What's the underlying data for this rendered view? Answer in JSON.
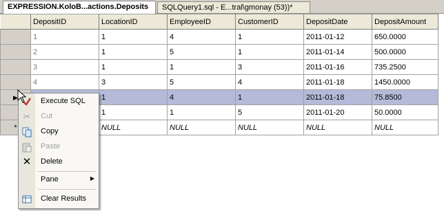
{
  "tabs": [
    {
      "label": "EXPRESSION.KoloB...actions.Deposits"
    },
    {
      "label": "SQLQuery1.sql - E...tral\\gmonay (53))*"
    }
  ],
  "grid": {
    "columns": [
      "DepositID",
      "LocationID",
      "EmployeeID",
      "CustomerID",
      "DepositDate",
      "DepositAmount"
    ],
    "rows": [
      [
        "1",
        "1",
        "4",
        "1",
        "2011-01-12",
        "650.0000"
      ],
      [
        "2",
        "1",
        "5",
        "1",
        "2011-01-14",
        "500.0000"
      ],
      [
        "3",
        "1",
        "1",
        "3",
        "2011-01-16",
        "735.2500"
      ],
      [
        "4",
        "3",
        "5",
        "4",
        "2011-01-18",
        "1450.0000"
      ],
      [
        "",
        "1",
        "4",
        "1",
        "2011-01-18",
        "75.8500"
      ],
      [
        "",
        "1",
        "1",
        "5",
        "2011-01-20",
        "50.0000"
      ],
      [
        "",
        "NULL",
        "NULL",
        "NULL",
        "NULL",
        "NULL"
      ]
    ],
    "current_row_marker": "▶",
    "new_row_marker": "*"
  },
  "context_menu": {
    "items": [
      {
        "label": "Execute SQL",
        "icon": "execute-sql-icon",
        "enabled": true
      },
      {
        "label": "Cut",
        "icon": "scissors-icon",
        "enabled": false
      },
      {
        "label": "Copy",
        "icon": "copy-icon",
        "enabled": true
      },
      {
        "label": "Paste",
        "icon": "paste-icon",
        "enabled": false
      },
      {
        "label": "Delete",
        "icon": "delete-x-icon",
        "enabled": true
      },
      {
        "label": "Pane",
        "icon": "",
        "enabled": true,
        "submenu": true
      },
      {
        "label": "Clear Results",
        "icon": "clear-results-icon",
        "enabled": true
      }
    ]
  },
  "colors": {
    "selected_row": "#b4bad8",
    "header_bg": "#ece9d8",
    "menu_gutter": "#e8e7de"
  }
}
